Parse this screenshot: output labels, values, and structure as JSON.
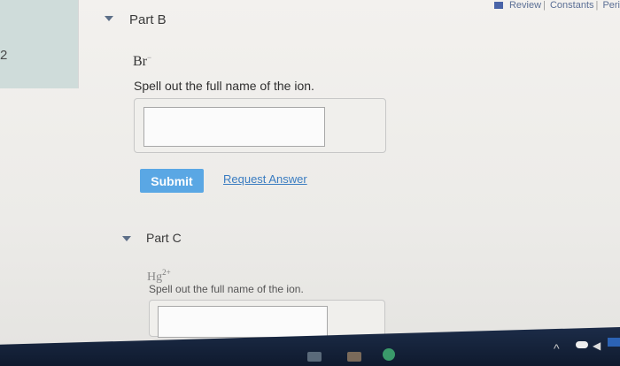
{
  "sidebar": {
    "item_number": "2"
  },
  "header": {
    "links": [
      "Review",
      "Constants",
      "Peri"
    ]
  },
  "part_b": {
    "title": "Part B",
    "formula_base": "Br",
    "formula_charge": "−",
    "instruction": "Spell out the full name of the ion.",
    "answer_value": "",
    "submit_label": "Submit",
    "request_label": "Request Answer"
  },
  "part_c": {
    "title": "Part C",
    "formula_base": "Hg",
    "formula_charge": "2+",
    "instruction": "Spell out the full name of the ion.",
    "answer_value": ""
  },
  "colors": {
    "submit": "#5aa7e4",
    "link": "#3a7cc1",
    "taskbar": "#14213a"
  }
}
